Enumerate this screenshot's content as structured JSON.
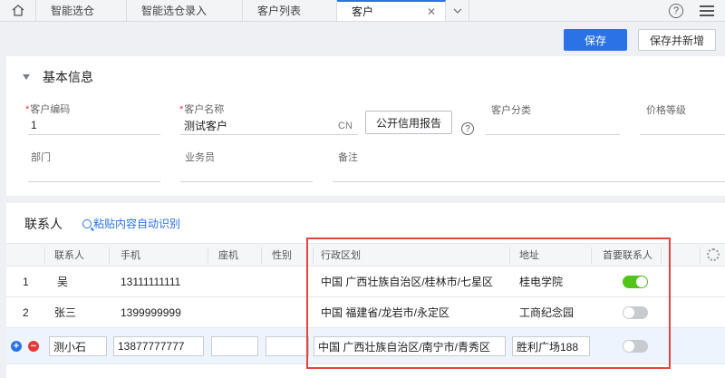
{
  "tabs": [
    {
      "label": "智能选仓"
    },
    {
      "label": "智能选仓录入"
    },
    {
      "label": "客户列表"
    },
    {
      "label": "客户",
      "active": true
    }
  ],
  "topbar": {
    "help": "?"
  },
  "toolbar": {
    "save_label": "保存",
    "save_new_label": "保存并新增"
  },
  "basic": {
    "title": "基本信息",
    "customer_code_label": "客户编码",
    "customer_code_value": "1",
    "customer_name_label": "客户名称",
    "customer_name_value": "测试客户",
    "lang_tag": "CN",
    "credit_report_label": "公开信用报告",
    "help_mark": "?",
    "category_label": "客户分类",
    "price_level_label": "价格等级",
    "dept_label": "部门",
    "salesman_label": "业务员",
    "remark_label": "备注",
    "required_mark": "*"
  },
  "contacts": {
    "title": "联系人",
    "paste_label": "粘贴内容自动识别",
    "columns": {
      "name": "联系人",
      "phone": "手机",
      "landline": "座机",
      "gender": "性别",
      "region": "行政区划",
      "address": "地址",
      "primary": "首要联系人"
    },
    "rows": [
      {
        "index": "1",
        "name": "吴",
        "phone": "13111111111",
        "landline": "",
        "gender": "",
        "region": "中国 广西壮族自治区/桂林市/七星区",
        "address": "桂电学院",
        "primary": true
      },
      {
        "index": "2",
        "name": "张三",
        "phone": "1399999999",
        "landline": "",
        "gender": "",
        "region": "中国 福建省/龙岩市/永定区",
        "address": "工商纪念园",
        "primary": false
      }
    ],
    "edit_row": {
      "name": "测小石",
      "phone": "13877777777",
      "landline": "",
      "gender": "",
      "region": "中国 广西壮族自治区/南宁市/青秀区",
      "address": "胜利广场188",
      "primary": false
    }
  },
  "colors": {
    "accent": "#2a72e5",
    "toggle_on": "#52c41a",
    "highlight": "#e0463c",
    "required": "#e53935"
  }
}
